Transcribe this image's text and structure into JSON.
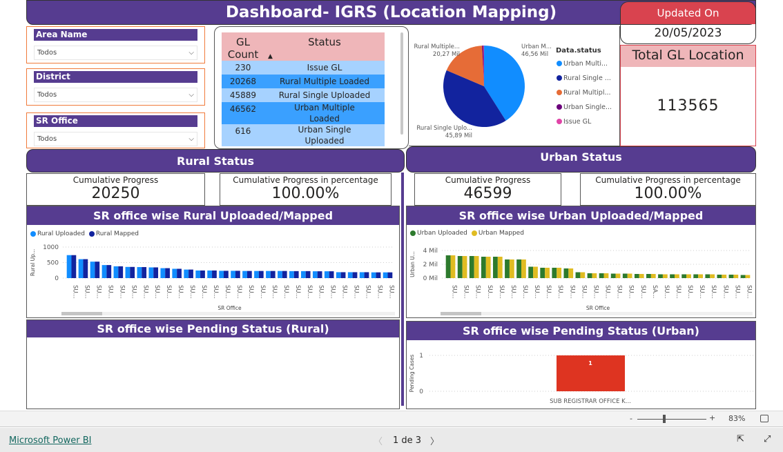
{
  "header": {
    "title": "Dashboard- IGRS (Location Mapping)"
  },
  "updated": {
    "label": "Updated On",
    "date": "20/05/2023"
  },
  "total": {
    "label": "Total GL Location",
    "value": "113565"
  },
  "slicers": [
    {
      "label": "Area Name",
      "value": "Todos"
    },
    {
      "label": "District",
      "value": "Todos"
    },
    {
      "label": "SR Office",
      "value": "Todos"
    }
  ],
  "table": {
    "headers": [
      "GL Count",
      "Status"
    ],
    "rows": [
      [
        "230",
        "Issue GL"
      ],
      [
        "20268",
        "Rural Multiple Loaded"
      ],
      [
        "45889",
        "Rural Single Uploaded"
      ],
      [
        "46562",
        "Urban Multiple Loaded"
      ],
      [
        "616",
        "Urban Single Uploaded"
      ]
    ]
  },
  "colors": {
    "purple": "#563c90",
    "updated_red": "#d9434f",
    "pink_header": "#efb6b9",
    "rural_uploaded": "#118dff",
    "rural_mapped": "#12239e",
    "urban_uploaded": "#2d7a2d",
    "urban_mapped": "#e0bc22",
    "pending": "#de3421"
  },
  "chart_data": [
    {
      "type": "pie",
      "legend_title": "Data.status",
      "legend_position": "right",
      "slices": [
        {
          "name": "Urban Multiple Loaded",
          "legend": "Urban Multi...",
          "value": 46562,
          "label": "Urban M...",
          "value_label": "46,56 Mil",
          "color": "#118dff"
        },
        {
          "name": "Rural Single Uploaded",
          "legend": "Rural Single ...",
          "value": 45889,
          "label": "Rural Single Uplo...",
          "value_label": "45,89 Mil",
          "color": "#12239e"
        },
        {
          "name": "Rural Multiple Loaded",
          "legend": "Rural Multipl...",
          "value": 20268,
          "label": "Rural Multiple...",
          "value_label": "20,27 Mil",
          "color": "#e66c37"
        },
        {
          "name": "Urban Single Uploaded",
          "legend": "Urban Single...",
          "value": 616,
          "color": "#6b007b"
        },
        {
          "name": "Issue GL",
          "legend": "Issue GL",
          "value": 230,
          "color": "#e044a7"
        }
      ]
    },
    {
      "type": "bar",
      "title": "SR office wise Rural Uploaded/Mapped",
      "xlabel": "SR Office",
      "ylabel": "Rural Up...",
      "ylim": [
        0,
        1000
      ],
      "yticks": [
        "0",
        "500",
        "1000"
      ],
      "ytick_values": [
        0,
        500,
        1000
      ],
      "grid": true,
      "legend_position": "top-left",
      "categories": [
        "SU...",
        "SU...",
        "SU...",
        "SU...",
        "SU...",
        "SU...",
        "SU...",
        "SU...",
        "SU...",
        "SU...",
        "SU...",
        "SU...",
        "SU...",
        "SU...",
        "SU...",
        "SU...",
        "SU...",
        "SU...",
        "SU...",
        "SU...",
        "SU...",
        "SU...",
        "SU...",
        "SU...",
        "SU...",
        "SU...",
        "SU...",
        "SU..."
      ],
      "series": [
        {
          "name": "Rural Uploaded",
          "color": "#118dff",
          "values": [
            740,
            610,
            530,
            420,
            380,
            360,
            355,
            345,
            320,
            300,
            275,
            245,
            245,
            235,
            235,
            230,
            230,
            230,
            230,
            225,
            225,
            220,
            220,
            190,
            190,
            190,
            185,
            185
          ]
        },
        {
          "name": "Rural Mapped",
          "color": "#12239e",
          "values": [
            740,
            610,
            530,
            420,
            380,
            360,
            355,
            345,
            320,
            300,
            275,
            245,
            245,
            235,
            235,
            230,
            230,
            230,
            230,
            225,
            225,
            220,
            220,
            190,
            190,
            190,
            185,
            185
          ]
        }
      ]
    },
    {
      "type": "bar",
      "title": "SR office wise Urban Uploaded/Mapped",
      "xlabel": "SR Office",
      "ylabel": "Urban U...",
      "ylim": [
        0,
        4000000
      ],
      "yticks": [
        "0 Mil",
        "2 Mil",
        "4 Mil"
      ],
      "ytick_values": [
        0,
        2000000,
        4000000
      ],
      "grid": true,
      "legend_position": "top-left",
      "categories": [
        "SU...",
        "SU...",
        "SU...",
        "SU...",
        "SU...",
        "SU...",
        "SU...",
        "SU...",
        "SU...",
        "SU...",
        "SU...",
        "SU...",
        "SU...",
        "SU...",
        "SU...",
        "SU...",
        "SU...",
        "SA...",
        "SU...",
        "SU...",
        "SU...",
        "SU...",
        "SU...",
        "SU...",
        "SU...",
        "SU..."
      ],
      "series": [
        {
          "name": "Urban Uploaded",
          "color": "#2d7a2d",
          "values": [
            3300000,
            3200000,
            3200000,
            3100000,
            3100000,
            2700000,
            2700000,
            1650000,
            1500000,
            1500000,
            1400000,
            850000,
            700000,
            700000,
            650000,
            650000,
            600000,
            600000,
            550000,
            550000,
            550000,
            550000,
            550000,
            500000,
            500000,
            450000
          ]
        },
        {
          "name": "Urban Mapped",
          "color": "#e0bc22",
          "values": [
            3300000,
            3200000,
            3200000,
            3100000,
            3100000,
            2700000,
            2700000,
            1650000,
            1500000,
            1500000,
            1400000,
            850000,
            700000,
            700000,
            650000,
            650000,
            600000,
            600000,
            550000,
            550000,
            550000,
            550000,
            550000,
            500000,
            500000,
            450000
          ]
        }
      ]
    },
    {
      "type": "bar",
      "title": "SR office wise Pending Status (Rural)",
      "categories": [],
      "values": []
    },
    {
      "type": "bar",
      "title": "SR office wise Pending Status (Urban)",
      "ylabel": "Pending Cases",
      "ylim": [
        0,
        1
      ],
      "yticks": [
        "0",
        "1"
      ],
      "ytick_values": [
        0,
        1
      ],
      "grid": true,
      "categories": [
        "SUB REGISTRAR OFFICE K..."
      ],
      "values": [
        1
      ],
      "data_labels": [
        "1"
      ],
      "color": "#de3421"
    }
  ],
  "rural": {
    "title": "Rural Status",
    "cum_label": "Cumulative Progress",
    "cum_value": "20250",
    "pct_label": "Cumulative Progress in percentage",
    "pct_value": "100.00%"
  },
  "urban": {
    "title": "Urban Status",
    "cum_label": "Cumulative Progress",
    "cum_value": "46599",
    "pct_label": "Cumulative Progress in percentage",
    "pct_value": "100.00%"
  },
  "zoombar": {
    "minus": "-",
    "plus": "+",
    "zoom": "83%",
    "zoom_percent": 83
  },
  "footer": {
    "brand": "Microsoft Power BI",
    "page": "1 de 3"
  }
}
